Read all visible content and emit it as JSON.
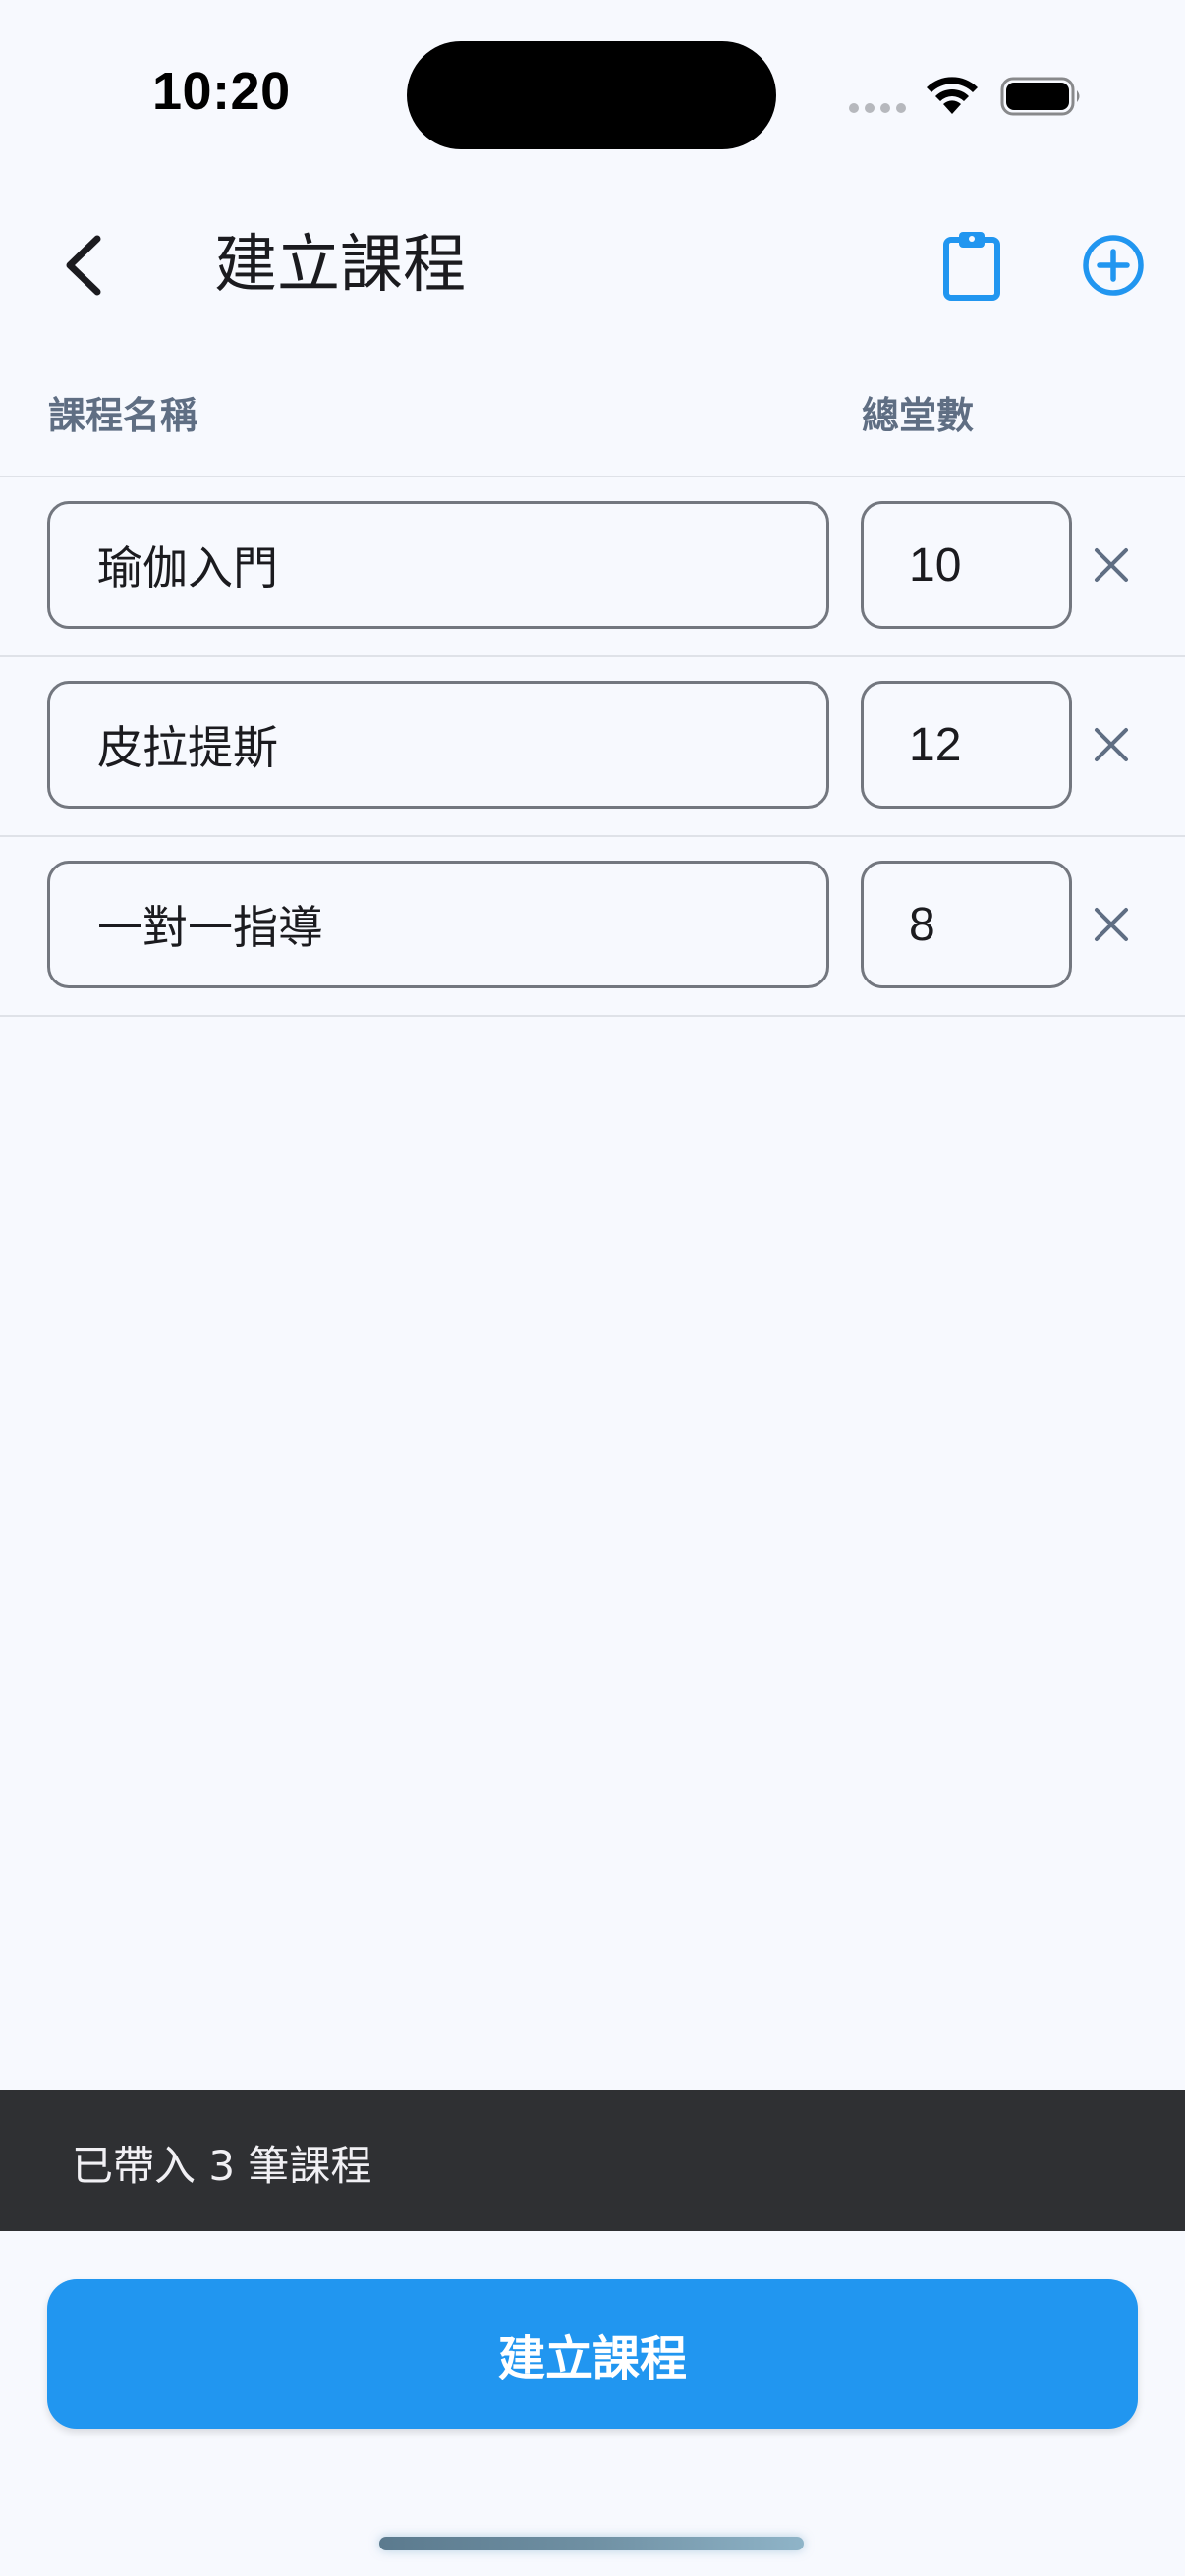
{
  "status_bar": {
    "time": "10:20"
  },
  "app_bar": {
    "title": "建立課程",
    "icons": {
      "back": "chevron-left-icon",
      "paste": "clipboard-icon",
      "add": "add-circle-icon"
    },
    "accent_color": "#2196f0"
  },
  "table": {
    "header_name": "課程名稱",
    "header_count": "總堂數",
    "rows": [
      {
        "name": "瑜伽入門",
        "count": "10"
      },
      {
        "name": "皮拉提斯",
        "count": "12"
      },
      {
        "name": "一對一指導",
        "count": "8"
      }
    ]
  },
  "snackbar": {
    "message": "已帶入 3 筆課程"
  },
  "primary_action": {
    "label": "建立課程",
    "color": "#2196f0"
  }
}
